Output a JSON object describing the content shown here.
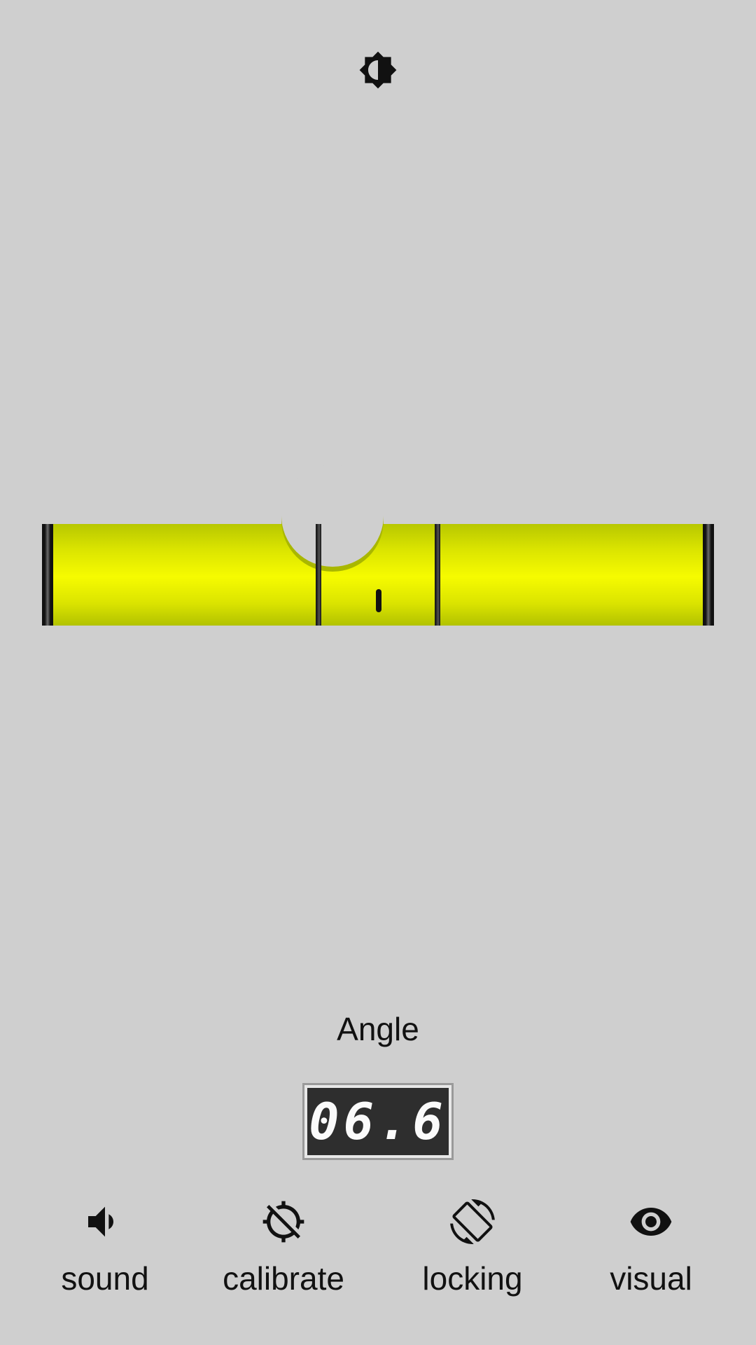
{
  "header": {
    "brightness_icon": "brightness-icon"
  },
  "level": {
    "bubble_offset_percent": -23.8,
    "tube_color": "#f6fb00"
  },
  "angle": {
    "label": "Angle",
    "value": "06.6"
  },
  "toolbar": {
    "items": [
      {
        "label": "sound",
        "icon": "volume-icon"
      },
      {
        "label": "calibrate",
        "icon": "calibrate-icon"
      },
      {
        "label": "locking",
        "icon": "screen-rotation-lock-icon"
      },
      {
        "label": "visual",
        "icon": "eye-icon"
      }
    ]
  }
}
